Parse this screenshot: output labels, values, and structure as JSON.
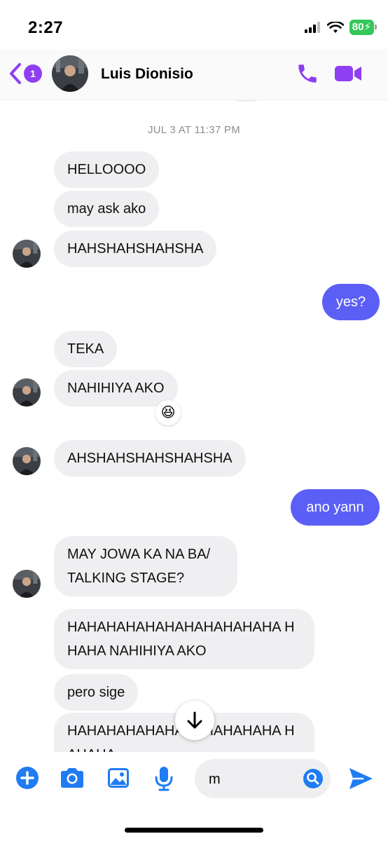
{
  "status": {
    "time": "2:27",
    "battery": "80"
  },
  "header": {
    "unread_count": "1",
    "contact_name": "Luis Dionisio"
  },
  "conversation": {
    "timestamp": "JUL 3 AT 11:37 PM",
    "messages": [
      {
        "from": "them",
        "text": "HELLOOOO"
      },
      {
        "from": "them",
        "text": "may ask ako"
      },
      {
        "from": "them",
        "text": "HAHSHAHSHAHSHA"
      },
      {
        "from": "me",
        "text": "yes?"
      },
      {
        "from": "them",
        "text": "TEKA"
      },
      {
        "from": "them",
        "text": "NAHIHIYA AKO",
        "reaction": "😆"
      },
      {
        "from": "them",
        "text": "AHSHAHSHAHSHAHSHA"
      },
      {
        "from": "me",
        "text": "ano yann"
      },
      {
        "from": "them",
        "text": "MAY JOWA KA NA BA/ TALKING STAGE?"
      },
      {
        "from": "them",
        "text": "HAHAHAHAHAHAHAHAHAHAHA HHAHA NAHIHIYA AKO"
      },
      {
        "from": "them",
        "text": "pero sige"
      },
      {
        "from": "them",
        "text": "HAHAHAHAHAHAHAHAHAHAHA HAHAHA"
      }
    ]
  },
  "composer": {
    "input_value": "m"
  },
  "colors": {
    "accent": "#8e3ff2",
    "outgoing": "#5b5ff5",
    "incoming": "#efeff1",
    "tool_blue": "#1f7cf2"
  }
}
